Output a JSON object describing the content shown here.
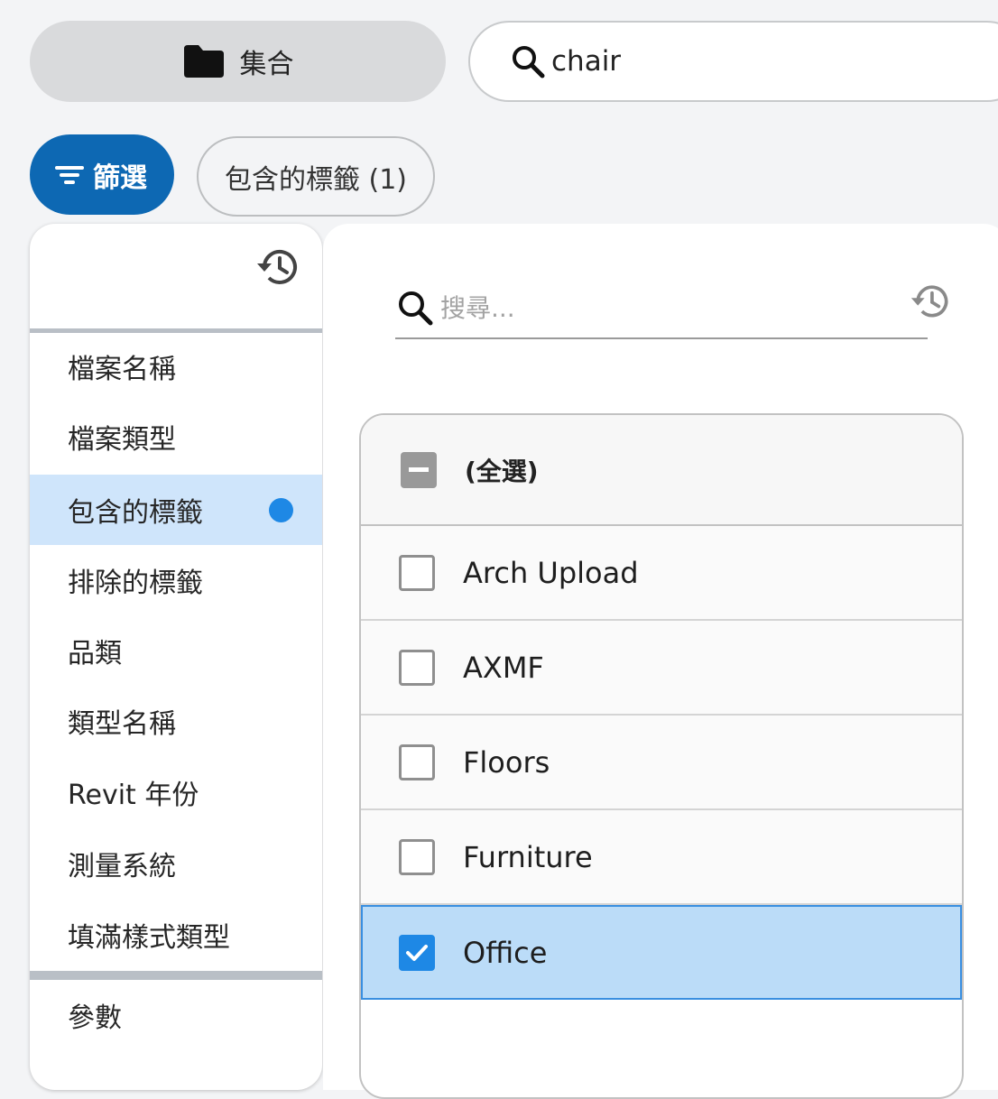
{
  "toolbar": {
    "collection_label": "集合",
    "collection_icon": "folder-icon",
    "search_value": "chair",
    "search_icon": "search-icon"
  },
  "filter_bar": {
    "filter_button_label": "篩選",
    "filter_icon": "filter-icon",
    "active_filter_chip": "包含的標籤 (1)"
  },
  "field_panel": {
    "history_icon": "history-icon",
    "fields": [
      {
        "label": "檔案名稱",
        "active": false
      },
      {
        "label": "檔案類型",
        "active": false
      },
      {
        "label": "包含的標籤",
        "active": true
      },
      {
        "label": "排除的標籤",
        "active": false
      },
      {
        "label": "品類",
        "active": false
      },
      {
        "label": "類型名稱",
        "active": false
      },
      {
        "label": "Revit 年份",
        "active": false
      },
      {
        "label": "測量系統",
        "active": false
      },
      {
        "label": "填滿樣式類型",
        "active": false
      }
    ],
    "parameters_label": "參數"
  },
  "value_panel": {
    "search_placeholder": "搜尋...",
    "select_all_label": "(全選)",
    "select_all_state": "indeterminate",
    "values": [
      {
        "label": "Arch Upload",
        "checked": false
      },
      {
        "label": "AXMF",
        "checked": false
      },
      {
        "label": "Floors",
        "checked": false
      },
      {
        "label": "Furniture",
        "checked": false
      },
      {
        "label": "Office",
        "checked": true
      }
    ]
  },
  "colors": {
    "primary": "#0d68b3",
    "active_item": "#cfe5fb",
    "active_dot": "#1e88e5",
    "checked_row": "#bbdcf8",
    "checkbox_checked": "#1e88e5"
  }
}
